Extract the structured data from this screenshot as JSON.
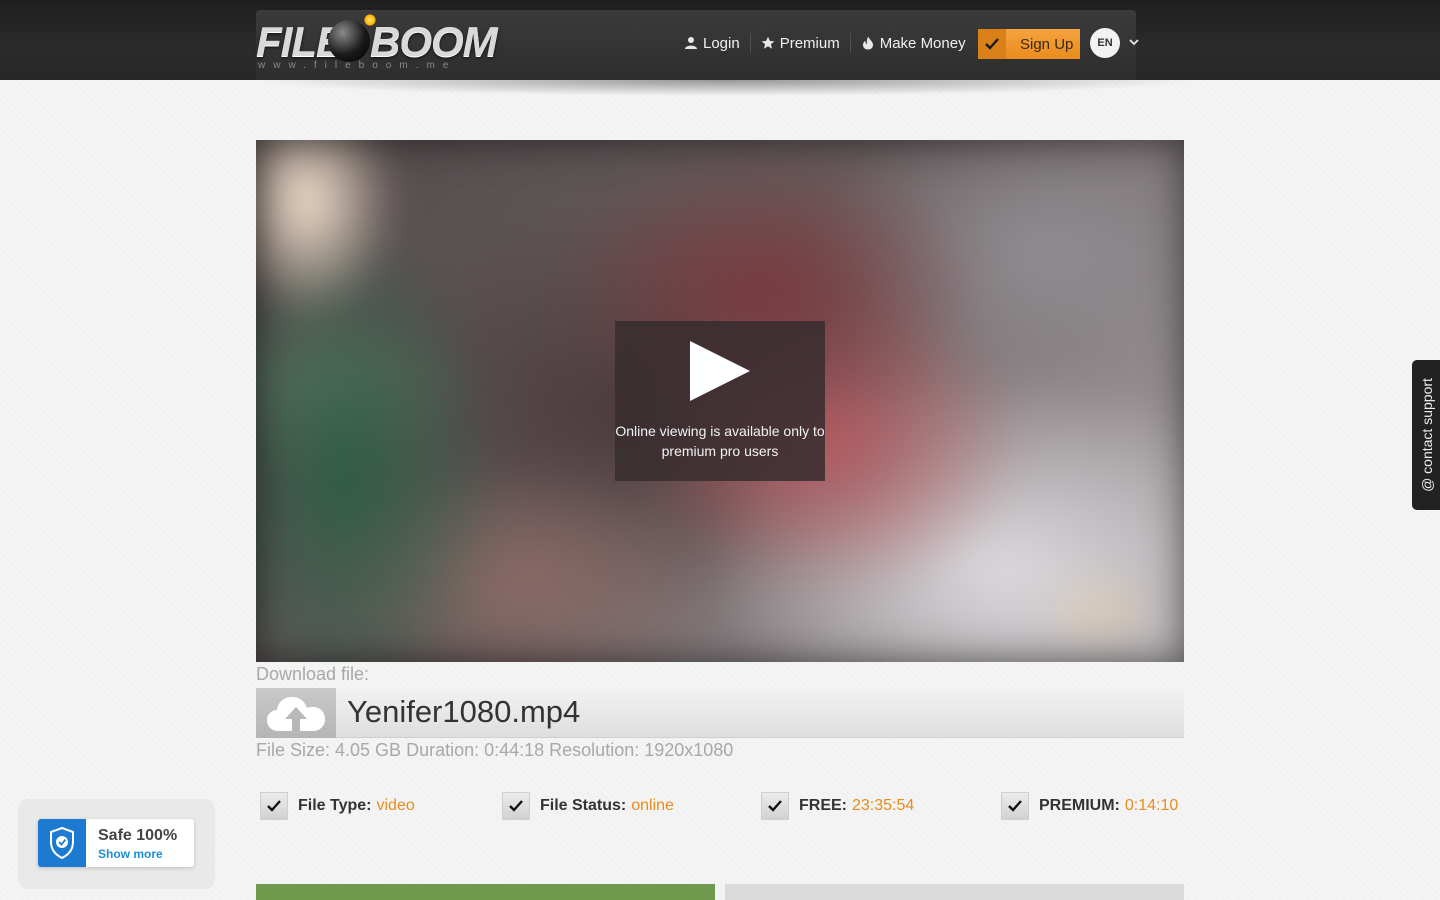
{
  "header": {
    "logo_word_left": "FILE",
    "logo_word_right": "BOOM",
    "logo_url": "www.fileboom.me",
    "nav": [
      {
        "label": "Login",
        "icon": "user-icon"
      },
      {
        "label": "Premium",
        "icon": "star-icon"
      },
      {
        "label": "Make Money",
        "icon": "flame-icon"
      }
    ],
    "signup_label": "Sign Up",
    "language": "EN"
  },
  "video": {
    "message": "Online viewing is available only to premium pro users"
  },
  "download": {
    "label": "Download file:",
    "file_name": "Yenifer1080.mp4",
    "meta": "File Size: 4.05 GB Duration: 0:44:18 Resolution: 1920x1080"
  },
  "stats": [
    {
      "label": "File Type:",
      "value": "video"
    },
    {
      "label": "File Status:",
      "value": "online"
    },
    {
      "label": "FREE:",
      "value": "23:35:54"
    },
    {
      "label": "PREMIUM:",
      "value": "0:14:10"
    }
  ],
  "safe_badge": {
    "title": "Safe 100%",
    "more": "Show more"
  },
  "support": {
    "label": "@ contact support"
  },
  "colors": {
    "accent": "#e98c1c",
    "header_bg": "#2b2b2b",
    "download_green": "#6f994c",
    "shield_blue": "#1c7bd0"
  }
}
